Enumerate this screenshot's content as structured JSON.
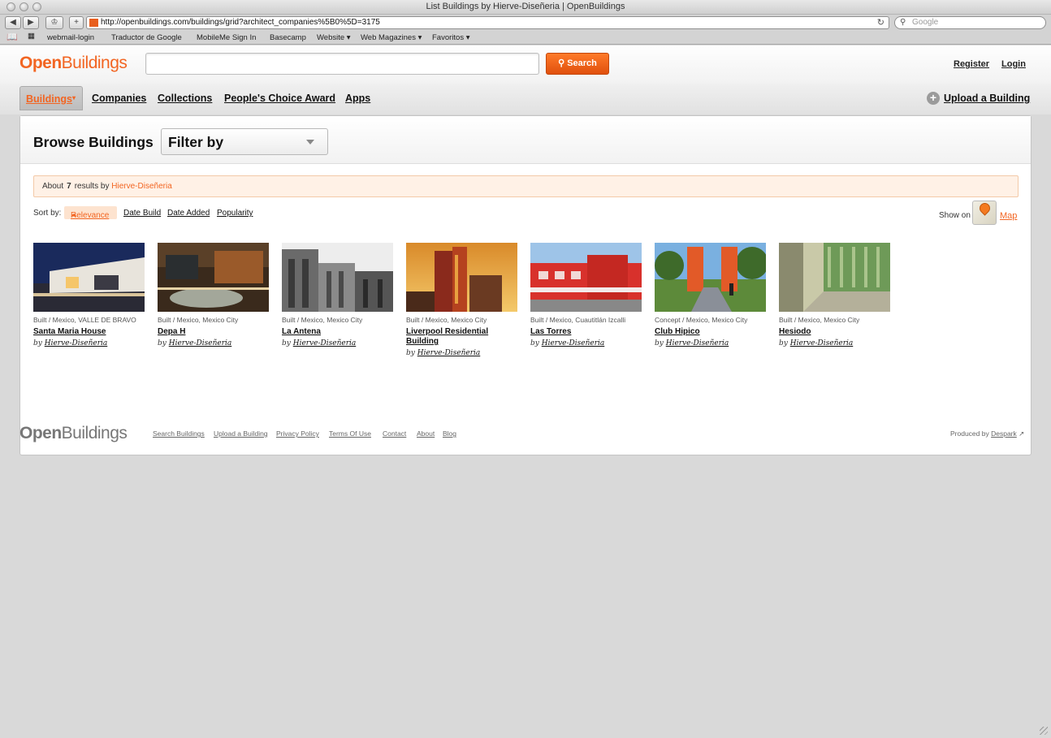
{
  "window": {
    "title": "List Buildings by Hierve-Diseñeria | OpenBuildings"
  },
  "toolbar": {
    "url": "http://openbuildings.com/buildings/grid?architect_companies%5B0%5D=3175",
    "search_placeholder": "Google"
  },
  "bookmarks": [
    "webmail-login",
    "Traductor de Google",
    "MobileMe Sign In",
    "Basecamp",
    "Website ▾",
    "Web Magazines ▾",
    "Favoritos ▾"
  ],
  "header": {
    "logo_a": "Open",
    "logo_b": "Buildings",
    "search_button": "Search",
    "register": "Register",
    "login": "Login"
  },
  "nav": {
    "active": "Buildings",
    "items": [
      "Companies",
      "Collections",
      "People's Choice Award",
      "Apps"
    ],
    "upload": "Upload a Building"
  },
  "browse": {
    "title": "Browse Buildings",
    "filter": "Filter by",
    "results_prefix": "About",
    "results_count": "7",
    "results_mid": "results by",
    "results_company": "Hierve-Diseñeria",
    "sort_label": "Sort by:",
    "sort_active": "Relevance",
    "sort_options": [
      "Date Build",
      "Date Added",
      "Popularity"
    ],
    "show_on": "Show on",
    "map": "Map"
  },
  "buildings": [
    {
      "status": "Built / Mexico, VALLE DE BRAVO",
      "name": "Santa Maria House",
      "by": "by",
      "architect": "Hierve-Diseñeria"
    },
    {
      "status": "Built / Mexico, Mexico City",
      "name": "Depa H",
      "by": "by",
      "architect": "Hierve-Diseñeria"
    },
    {
      "status": "Built / Mexico, Mexico City",
      "name": "La Antena",
      "by": "by",
      "architect": "Hierve-Diseñeria"
    },
    {
      "status": "Built / Mexico, Mexico City",
      "name": "Liverpool Residential Building",
      "by": "by",
      "architect": "Hierve-Diseñeria"
    },
    {
      "status": "Built / Mexico, Cuautitlán Izcalli",
      "name": "Las Torres",
      "by": "by",
      "architect": "Hierve-Diseñeria"
    },
    {
      "status": "Concept / Mexico, Mexico City",
      "name": "Club Hipico",
      "by": "by",
      "architect": "Hierve-Diseñeria"
    },
    {
      "status": "Built / Mexico, Mexico City",
      "name": "Hesiodo",
      "by": "by",
      "architect": "Hierve-Diseñeria"
    }
  ],
  "footer": {
    "logo_a": "Open",
    "logo_b": "Buildings",
    "links": [
      "Search Buildings",
      "Upload a Building",
      "Privacy Policy",
      "Terms Of Use",
      "Contact",
      "About",
      "Blog"
    ],
    "produced_by": "Produced by",
    "producer": "Despark"
  },
  "colors": {
    "brand": "#f26522",
    "page_bg": "#d9d9d9"
  }
}
